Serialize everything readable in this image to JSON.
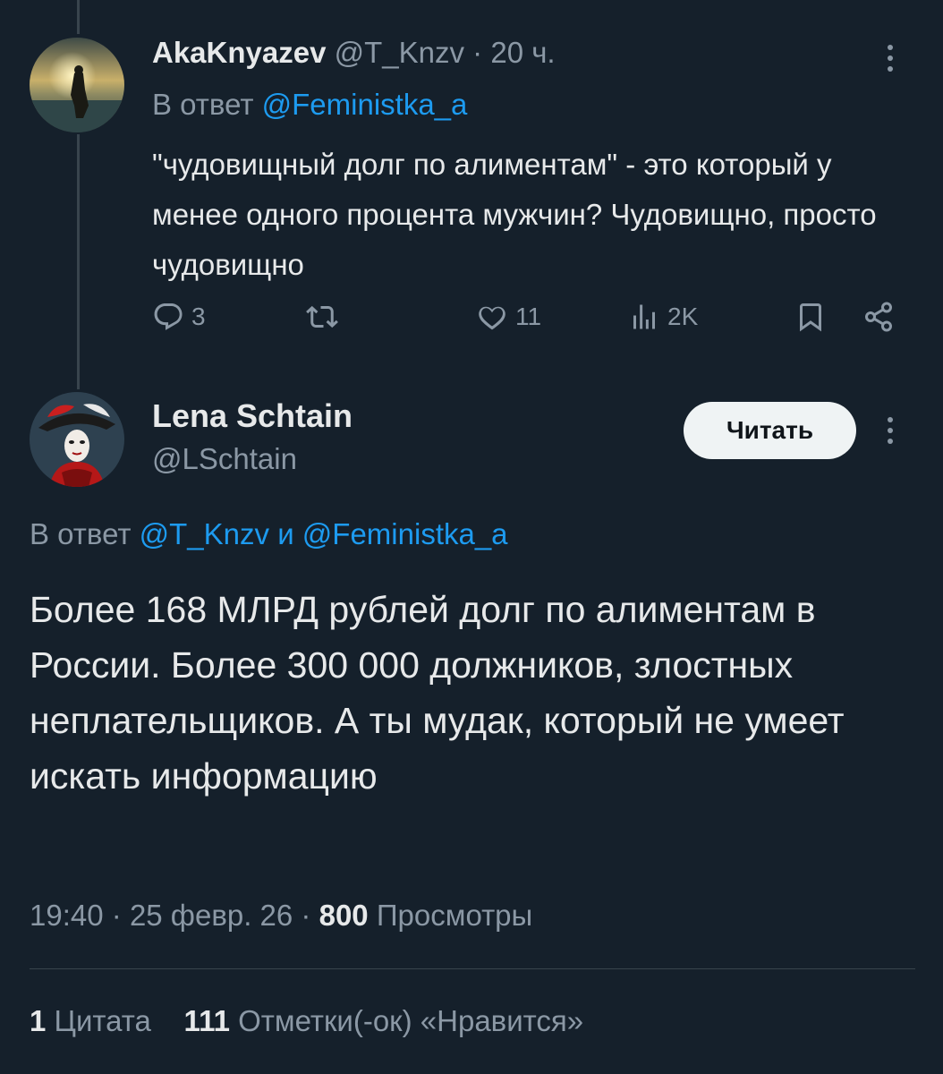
{
  "reply_tweet": {
    "author_name": "AkaKnyazev",
    "author_handle": "@T_Knzv",
    "separator": "·",
    "time_ago": "20 ч.",
    "reply_prefix": "В ответ",
    "reply_to": "@Feministka_a",
    "text": "\"чудовищный долг по алиментам\" - это который у менее одного процента мужчин? Чудовищно, просто чудовищно",
    "stats": {
      "replies": "3",
      "retweets": "",
      "likes": "11",
      "views": "2K"
    }
  },
  "main_tweet": {
    "author_name": "Lena Schtain",
    "author_handle": "@LSchtain",
    "follow_label": "Читать",
    "reply_prefix": "В ответ",
    "reply_to_1": "@T_Knzv",
    "reply_joiner": "и",
    "reply_to_2": "@Feministka_a",
    "text": "Более 168 МЛРД рублей долг по алиментам в России. Более 300 000 должников, злостных неплательщиков. А ты мудак, который не умеет искать информацию",
    "time": "19:40",
    "date": "25 февр. 26",
    "sep": "·",
    "views_count": "800",
    "views_label": "Просмотры",
    "quotes_count": "1",
    "quotes_label": "Цитата",
    "likes_count": "111",
    "likes_label": "Отметки(-ок) «Нравится»"
  },
  "colors": {
    "background": "#15202b",
    "link": "#1d9bf0",
    "muted": "#8b98a5",
    "text": "#e7e9ea"
  }
}
